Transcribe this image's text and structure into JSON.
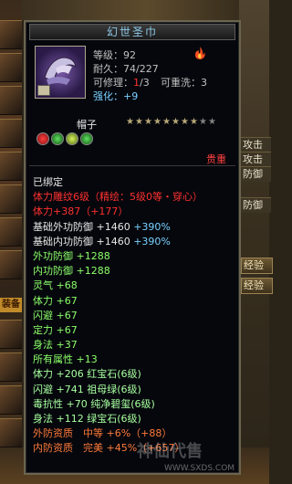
{
  "side_tabs": [
    "攻击",
    "攻击",
    "防御",
    "防御",
    "经验",
    "经验"
  ],
  "equip_tab": "装备",
  "title": "幻世圣巾",
  "level": "等级：92",
  "durability": "耐久：74/227",
  "repair": {
    "label": "可修理：",
    "value": "1",
    "sep": "/",
    "max": "3"
  },
  "rewash": "可重洗：3",
  "enhance": {
    "label": "强化：",
    "value": "+9"
  },
  "item_type": "帽子",
  "stars": {
    "lit": 8,
    "total": 10
  },
  "gems": [
    "red",
    "green",
    "yellow-green",
    "green"
  ],
  "price": "贵重",
  "lines": [
    {
      "text": "已绑定",
      "color": "white"
    },
    {
      "text": "体力雕纹6级（精绘：5级0等・穿心）",
      "color": "red"
    },
    {
      "text": "体力+387（+177）",
      "color": "red"
    },
    {
      "text": "基础外功防御 +1460",
      "extra": " +390%",
      "color": "white",
      "extra_color": "cyan"
    },
    {
      "text": "基础内功防御 +1460",
      "extra": " +390%",
      "color": "white",
      "extra_color": "cyan"
    },
    {
      "text": "外功防御 +1288",
      "color": "green"
    },
    {
      "text": "内功防御 +1288",
      "color": "green"
    },
    {
      "text": "灵气 +68",
      "color": "green"
    },
    {
      "text": "体力 +67",
      "color": "green"
    },
    {
      "text": "闪避 +67",
      "color": "green"
    },
    {
      "text": "定力 +67",
      "color": "green"
    },
    {
      "text": "身法 +37",
      "color": "green"
    },
    {
      "text": "所有属性 +13",
      "color": "green"
    },
    {
      "text": "体力 +206 红宝石(6级)",
      "color": "lightgreen"
    },
    {
      "text": "闪避 +741 祖母绿(6级)",
      "color": "lightgreen"
    },
    {
      "text": "毒抗性 +70 纯净碧玺(6级)",
      "color": "lightgreen"
    },
    {
      "text": "身法 +112 绿宝石(6级)",
      "color": "lightgreen"
    },
    {
      "text": "外防资质　中等 +6%（+88）",
      "color": "orange"
    },
    {
      "text": "内防资质　完美 +45%（+657）",
      "color": "orange"
    }
  ],
  "watermark": "神仙代售",
  "watermark_url": "WWW.SXDS.COM"
}
